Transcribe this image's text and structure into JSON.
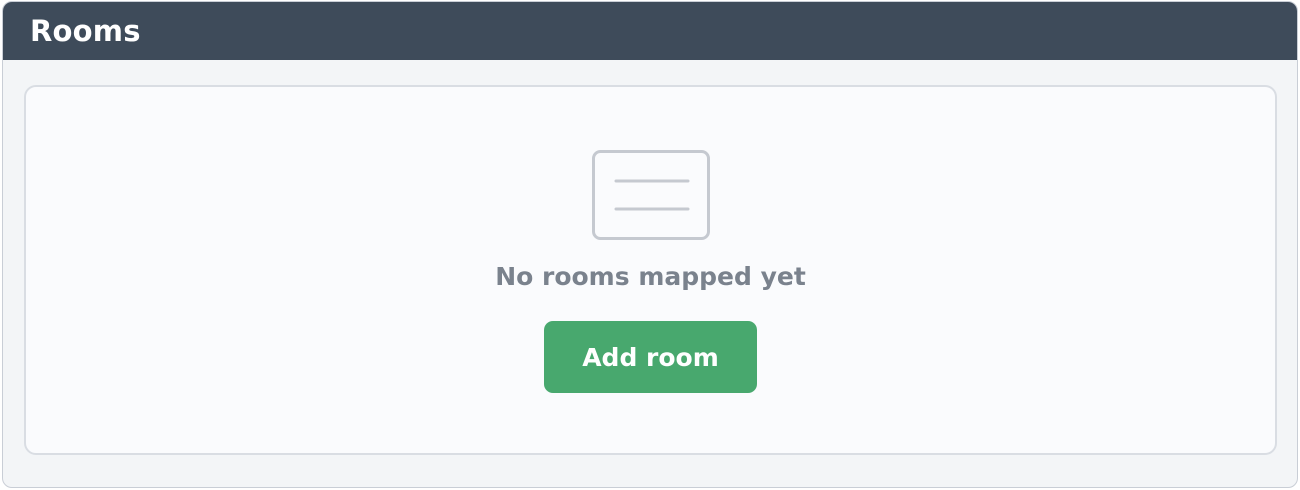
{
  "panel": {
    "title": "Rooms"
  },
  "empty_state": {
    "icon": "empty-list-icon",
    "message": "No rooms mapped yet",
    "action_label": "Add room"
  },
  "colors": {
    "header_bg": "#3e4b5a",
    "button_bg": "#48a86e",
    "message_text": "#7a828d"
  }
}
